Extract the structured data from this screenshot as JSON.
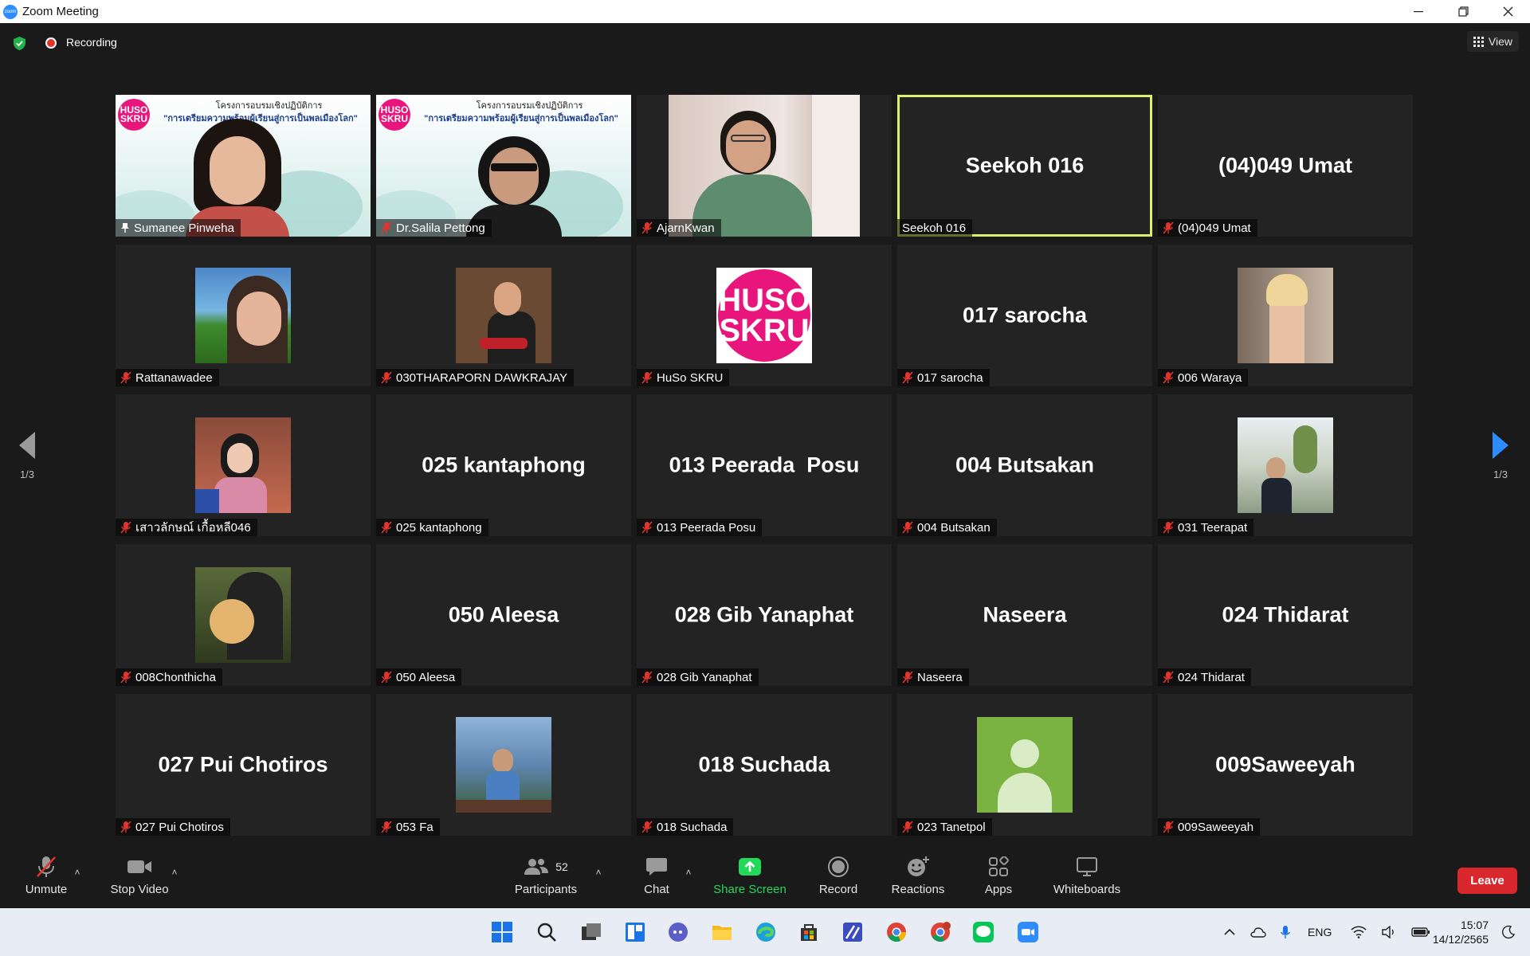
{
  "window": {
    "title": "Zoom Meeting",
    "logo_text": "zoom"
  },
  "top_bar": {
    "recording_label": "Recording",
    "view_label": "View"
  },
  "banner": {
    "logo_text": "HUSO SKRU",
    "line1": "โครงการอบรมเชิงปฏิบัติการ",
    "line2": "\"การเตรียมความพร้อมผู้เรียนสู่การเป็นพลเมืองโลก\""
  },
  "tiles": [
    {
      "name": "Sumanee Pinweha",
      "big": "",
      "kind": "banner",
      "pinned": true,
      "muted": false
    },
    {
      "name": "Dr.Salila Pettong",
      "big": "",
      "kind": "banner",
      "pinned": false,
      "muted": true
    },
    {
      "name": "AjarnKwan",
      "big": "",
      "kind": "video",
      "pinned": false,
      "muted": true
    },
    {
      "name": "Seekoh 016",
      "big": "Seekoh 016",
      "kind": "name",
      "active": true,
      "muted": false
    },
    {
      "name": "(04)049 Umat",
      "big": "(04)049 Umat",
      "kind": "name",
      "muted": true
    },
    {
      "name": "Rattanawadee",
      "big": "",
      "kind": "photo",
      "muted": true
    },
    {
      "name": "030THARAPORN DAWKRAJAY",
      "big": "",
      "kind": "photo",
      "muted": true
    },
    {
      "name": "HuSo SKRU",
      "big": "",
      "kind": "logo",
      "logo_text": "HUSO SKRU",
      "muted": true
    },
    {
      "name": "017 sarocha",
      "big": "017 sarocha",
      "kind": "name",
      "muted": true
    },
    {
      "name": "006 Waraya",
      "big": "",
      "kind": "photo",
      "muted": true
    },
    {
      "name": "เสาวลักษณ์ เกื้อหลี046",
      "big": "",
      "kind": "photo",
      "muted": true
    },
    {
      "name": "025 kantaphong",
      "big": "025 kantaphong",
      "kind": "name",
      "muted": true
    },
    {
      "name": "013 Peerada  Posu",
      "big": "013 Peerada  Posu",
      "kind": "name",
      "muted": true
    },
    {
      "name": "004 Butsakan",
      "big": "004 Butsakan",
      "kind": "name",
      "muted": true
    },
    {
      "name": "031 Teerapat",
      "big": "",
      "kind": "photo",
      "muted": true
    },
    {
      "name": "008Chonthicha",
      "big": "",
      "kind": "photo",
      "muted": true
    },
    {
      "name": "050 Aleesa",
      "big": "050 Aleesa",
      "kind": "name",
      "muted": true
    },
    {
      "name": "028 Gib Yanaphat",
      "big": "028 Gib Yanaphat",
      "kind": "name",
      "muted": true
    },
    {
      "name": "Naseera",
      "big": "Naseera",
      "kind": "name",
      "muted": true
    },
    {
      "name": "024 Thidarat",
      "big": "024 Thidarat",
      "kind": "name",
      "muted": true
    },
    {
      "name": "027 Pui Chotiros",
      "big": "027 Pui Chotiros",
      "kind": "name",
      "muted": true
    },
    {
      "name": "053 Fa",
      "big": "",
      "kind": "photo",
      "muted": true
    },
    {
      "name": "018 Suchada",
      "big": "018 Suchada",
      "kind": "name",
      "muted": true
    },
    {
      "name": "023 Tanetpol",
      "big": "",
      "kind": "avatar",
      "muted": true
    },
    {
      "name": "009Saweeyah",
      "big": "009Saweeyah",
      "kind": "name",
      "muted": true
    }
  ],
  "pager": {
    "left": "1/3",
    "right": "1/3"
  },
  "toolbar": {
    "unmute": "Unmute",
    "stop_video": "Stop Video",
    "participants": "Participants",
    "participants_count": "52",
    "chat": "Chat",
    "share_screen": "Share Screen",
    "record": "Record",
    "reactions": "Reactions",
    "apps": "Apps",
    "whiteboards": "Whiteboards",
    "leave": "Leave"
  },
  "taskbar": {
    "language": "ENG",
    "time": "15:07",
    "date": "14/12/2565",
    "apps": [
      "start-icon",
      "search-icon",
      "task-view-icon",
      "widgets-icon",
      "teams-chat-icon",
      "file-explorer-icon",
      "edge-icon",
      "store-icon",
      "app-icon",
      "chrome-icon",
      "chrome-profile-icon",
      "line-icon",
      "zoom-icon"
    ]
  },
  "colors": {
    "active_speaker": "#d9f26c",
    "share_green": "#23d959",
    "leave_red": "#d9272e",
    "zoom_blue": "#2d8cff",
    "muted_red": "#e0342c"
  }
}
